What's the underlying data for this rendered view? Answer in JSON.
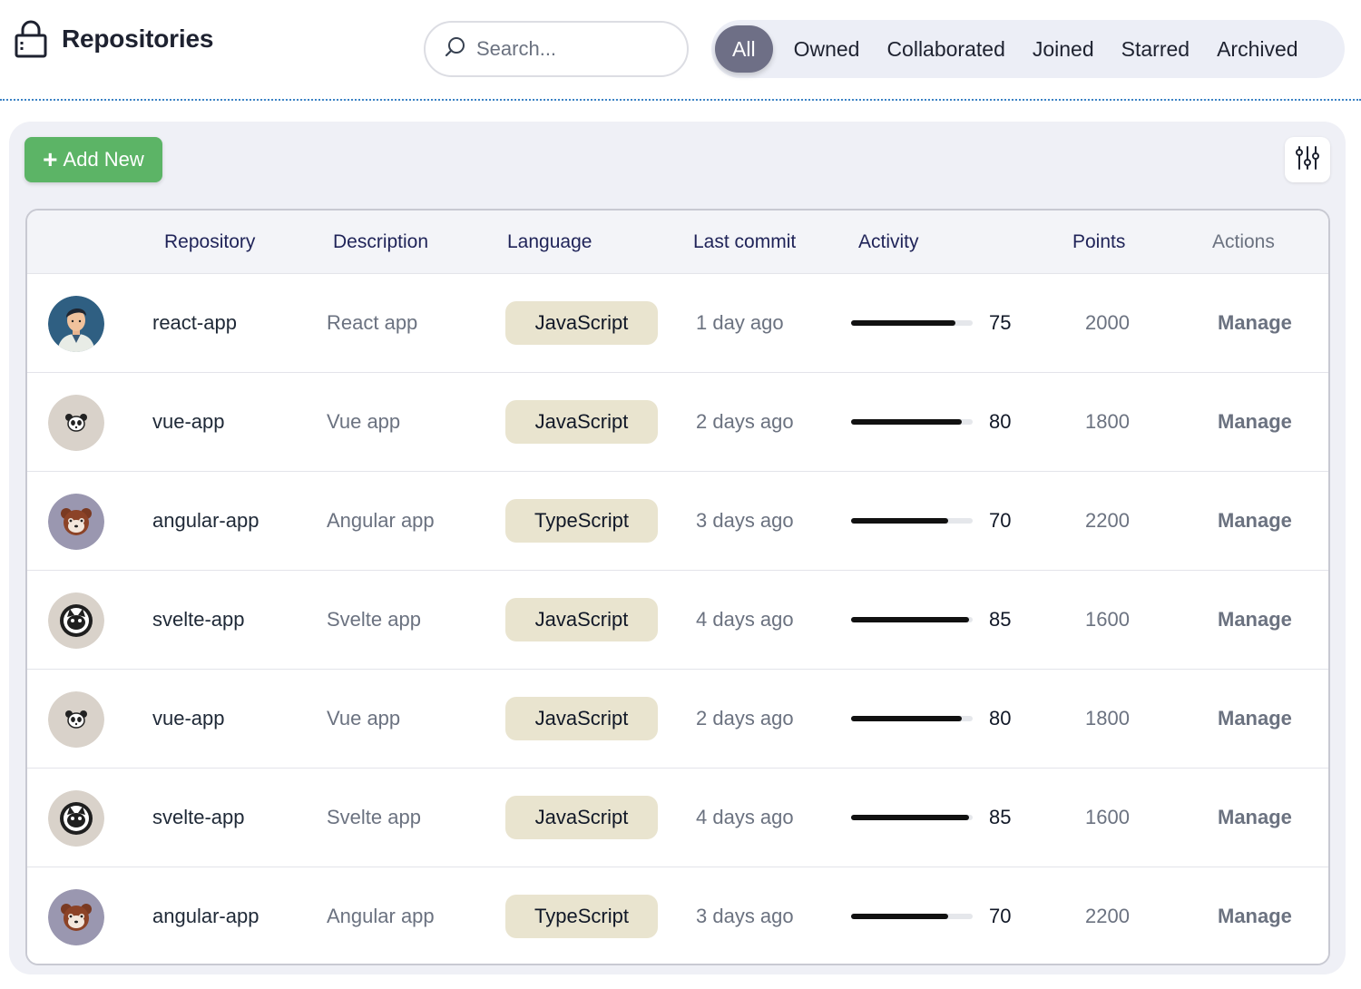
{
  "header": {
    "title": "Repositories",
    "icon": "lock-icon",
    "search": {
      "placeholder": "Search...",
      "value": ""
    },
    "filters": [
      "All",
      "Owned",
      "Collaborated",
      "Joined",
      "Starred",
      "Archived"
    ],
    "active_filter": "All"
  },
  "toolbar": {
    "add_label": "Add New",
    "add_color": "#5cb466",
    "settings_icon": "sliders-icon"
  },
  "table": {
    "columns": [
      "Repository",
      "Description",
      "Language",
      "Last commit",
      "Activity",
      "Points",
      "Actions"
    ],
    "rows": [
      {
        "avatar": "person",
        "name": "react-app",
        "description": "React app",
        "language": "JavaScript",
        "last_commit": "1 day ago",
        "activity": 75,
        "points": "2000",
        "action": "Manage"
      },
      {
        "avatar": "panda",
        "name": "vue-app",
        "description": "Vue app",
        "language": "JavaScript",
        "last_commit": "2 days ago",
        "activity": 80,
        "points": "1800",
        "action": "Manage"
      },
      {
        "avatar": "red-panda",
        "name": "angular-app",
        "description": "Angular app",
        "language": "TypeScript",
        "last_commit": "3 days ago",
        "activity": 70,
        "points": "2200",
        "action": "Manage"
      },
      {
        "avatar": "cat",
        "name": "svelte-app",
        "description": "Svelte app",
        "language": "JavaScript",
        "last_commit": "4 days ago",
        "activity": 85,
        "points": "1600",
        "action": "Manage"
      },
      {
        "avatar": "panda",
        "name": "vue-app",
        "description": "Vue app",
        "language": "JavaScript",
        "last_commit": "2 days ago",
        "activity": 80,
        "points": "1800",
        "action": "Manage"
      },
      {
        "avatar": "cat",
        "name": "svelte-app",
        "description": "Svelte app",
        "language": "JavaScript",
        "last_commit": "4 days ago",
        "activity": 85,
        "points": "1600",
        "action": "Manage"
      },
      {
        "avatar": "red-panda",
        "name": "angular-app",
        "description": "Angular app",
        "language": "TypeScript",
        "last_commit": "3 days ago",
        "activity": 70,
        "points": "2200",
        "action": "Manage"
      }
    ]
  }
}
